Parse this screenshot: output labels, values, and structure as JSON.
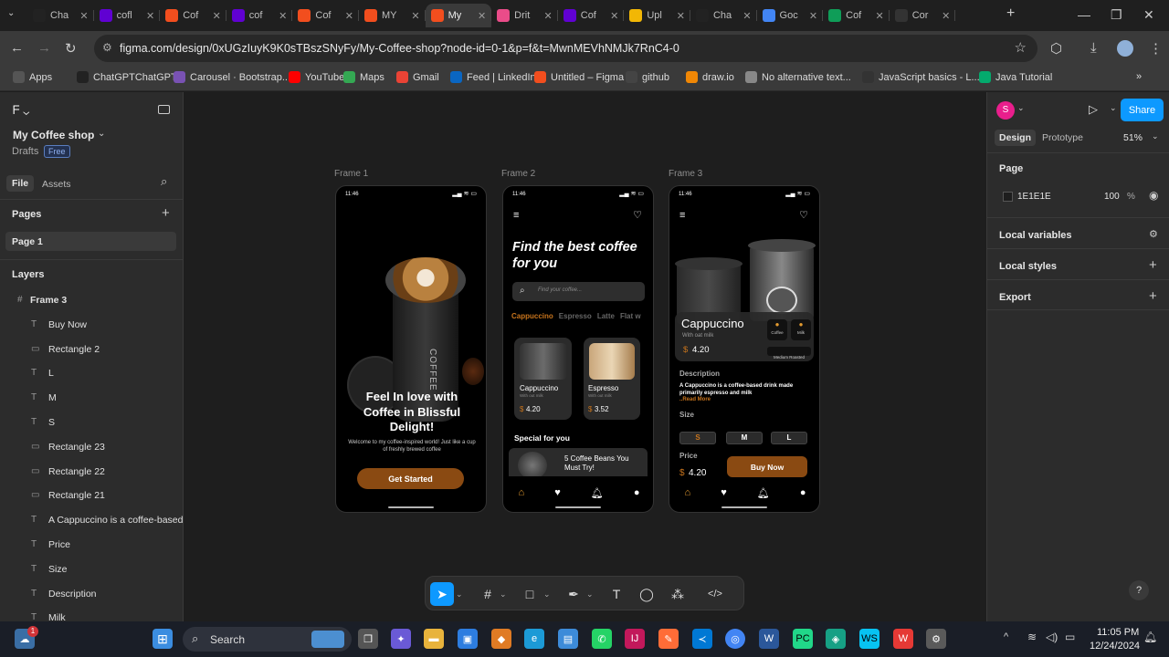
{
  "browser": {
    "tabs": [
      {
        "label": "Cha",
        "color": "#222",
        "icon": "chatgpt-icon"
      },
      {
        "label": "cofl",
        "color": "#6001d2",
        "icon": "yahoo-icon"
      },
      {
        "label": "Cof",
        "color": "#f24e1e",
        "icon": "figma-icon"
      },
      {
        "label": "cof",
        "color": "#6001d2",
        "icon": "yahoo-icon"
      },
      {
        "label": "Cof",
        "color": "#f24e1e",
        "icon": "figma-icon"
      },
      {
        "label": "MY",
        "color": "#f24e1e",
        "icon": "figma-icon"
      },
      {
        "label": "My",
        "color": "#f24e1e",
        "icon": "figma-icon",
        "active": true
      },
      {
        "label": "Drit",
        "color": "#ea4c89",
        "icon": "dribbble-icon"
      },
      {
        "label": "Cof",
        "color": "#6001d2",
        "icon": "yahoo-icon"
      },
      {
        "label": "Upl",
        "color": "#f2b705",
        "icon": "upload-icon"
      },
      {
        "label": "Cha",
        "color": "#222",
        "icon": "chatgpt-icon"
      },
      {
        "label": "Goc",
        "color": "#4285f4",
        "icon": "google-icon"
      },
      {
        "label": "Cof",
        "color": "#0f9d58",
        "icon": "sheets-icon"
      },
      {
        "label": "Cor",
        "color": "#333",
        "icon": "loading-icon"
      }
    ],
    "url": "figma.com/design/0xUGzIuyK9K0sTBszSNyFy/My-Coffee-shop?node-id=0-1&p=f&t=MwnMEVhNMJk7RnC4-0",
    "bookmarks": [
      {
        "label": "Apps",
        "color": "#555"
      },
      {
        "label": "ChatGPTChatGPT",
        "color": "#222"
      },
      {
        "label": "Carousel · Bootstrap...",
        "color": "#7952b3"
      },
      {
        "label": "YouTube",
        "color": "#ff0000"
      },
      {
        "label": "Maps",
        "color": "#34a853"
      },
      {
        "label": "Gmail",
        "color": "#ea4335"
      },
      {
        "label": "Feed | LinkedIn",
        "color": "#0a66c2"
      },
      {
        "label": "Untitled – Figma",
        "color": "#f24e1e"
      },
      {
        "label": "github",
        "color": "#444"
      },
      {
        "label": "draw.io",
        "color": "#f08705"
      },
      {
        "label": "No alternative text...",
        "color": "#888"
      },
      {
        "label": "JavaScript basics - L...",
        "color": "#333"
      },
      {
        "label": "Java Tutorial",
        "color": "#04aa6d"
      }
    ]
  },
  "figma": {
    "project": "My Coffee shop",
    "drafts": "Drafts",
    "plan": "Free",
    "tabs": {
      "file": "File",
      "assets": "Assets"
    },
    "pages_heading": "Pages",
    "page": "Page 1",
    "layers_heading": "Layers",
    "layers": [
      {
        "label": "Frame 3",
        "icon": "#"
      },
      {
        "label": "Buy Now",
        "icon": "T"
      },
      {
        "label": "Rectangle 2",
        "icon": "▭"
      },
      {
        "label": "L",
        "icon": "T"
      },
      {
        "label": "M",
        "icon": "T"
      },
      {
        "label": "S",
        "icon": "T"
      },
      {
        "label": "Rectangle 23",
        "icon": "▭"
      },
      {
        "label": "Rectangle 22",
        "icon": "▭"
      },
      {
        "label": "Rectangle 21",
        "icon": "▭"
      },
      {
        "label": "A Cappuccino is a coffee-based d",
        "icon": "T"
      },
      {
        "label": "Price",
        "icon": "T"
      },
      {
        "label": "Size",
        "icon": "T"
      },
      {
        "label": "Description",
        "icon": "T"
      },
      {
        "label": "Milk",
        "icon": "T"
      }
    ],
    "right": {
      "avatar": "S",
      "share": "Share",
      "design": "Design",
      "prototype": "Prototype",
      "zoom": "51%",
      "page_heading": "Page",
      "bg_hex": "1E1E1E",
      "opacity": "100",
      "pct": "%",
      "local_variables": "Local variables",
      "local_styles": "Local styles",
      "export": "Export"
    },
    "frames": {
      "f1": {
        "label": "Frame 1",
        "time": "11:46",
        "title": "Feel In love with Coffee in Blissful Delight!",
        "subtitle": "Welcome to my coffee-inspired world! Just like a cup of freshly brewed coffee",
        "cta": "Get Started",
        "cup_text": "COFFEE"
      },
      "f2": {
        "label": "Frame 2",
        "time": "11:46",
        "title": "Find the best coffee for you",
        "search_placeholder": "Find your coffee...",
        "categories": [
          "Cappuccino",
          "Espresso",
          "Latte",
          "Flat w"
        ],
        "cards": [
          {
            "name": "Cappuccino",
            "sub": "With out milk",
            "cur": "$",
            "price": "4.20"
          },
          {
            "name": "Espresso",
            "sub": "With out milk",
            "cur": "$",
            "price": "3.52"
          }
        ],
        "special": "Special for you",
        "promo": "5 Coffee Beans You Must Try!"
      },
      "f3": {
        "label": "Frame 3",
        "time": "11:46",
        "name": "Cappuccino",
        "sub": "With oat milk",
        "cur": "$",
        "price": "4.20",
        "tag1": "Coffee",
        "tag2": "Milk",
        "roast": "Medium Roasted",
        "desc_h": "Description",
        "desc_b": "A Cappuccino",
        "desc_rest": " is a coffee-based drink made primarily espresso and milk",
        "read_more": "..Read More",
        "size_h": "Size",
        "sizes": [
          "S",
          "M",
          "L"
        ],
        "price_h": "Price",
        "price_val": "4.20",
        "buy": "Buy Now"
      }
    }
  },
  "taskbar": {
    "search": "Search",
    "time": "11:05 PM",
    "date": "12/24/2024",
    "badge": "1"
  }
}
